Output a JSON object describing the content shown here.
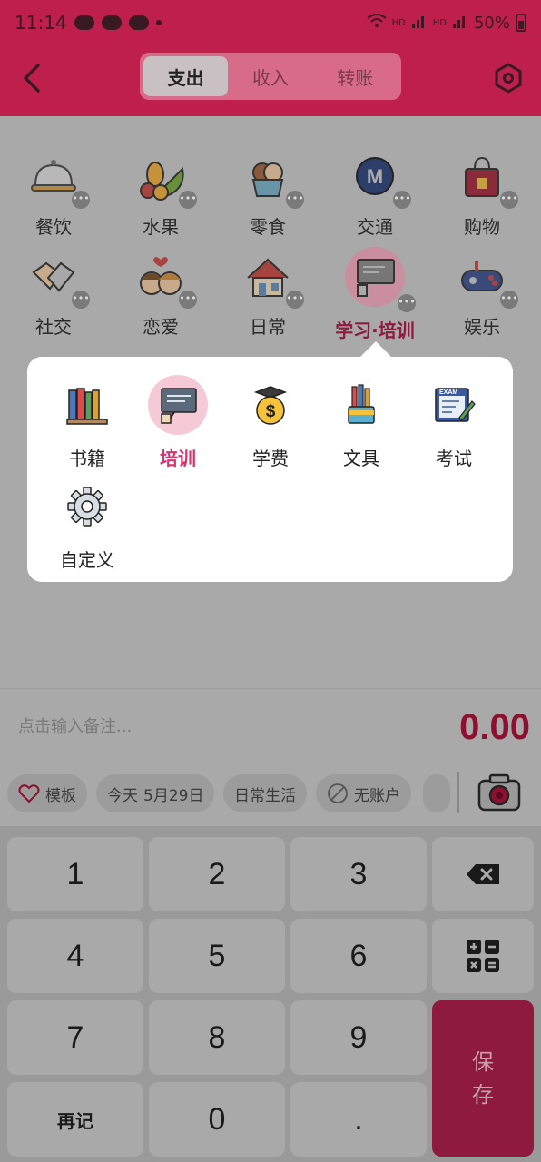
{
  "status": {
    "time": "11:14",
    "battery": "50%",
    "net1": "HD",
    "net2": "HD"
  },
  "header": {
    "tabs": [
      {
        "label": "支出",
        "active": true
      },
      {
        "label": "收入",
        "active": false
      },
      {
        "label": "转账",
        "active": false
      }
    ]
  },
  "categories": [
    {
      "label": "餐饮",
      "icon": "cloche-icon"
    },
    {
      "label": "水果",
      "icon": "fruit-icon"
    },
    {
      "label": "零食",
      "icon": "ice-cream-icon"
    },
    {
      "label": "交通",
      "icon": "metro-icon"
    },
    {
      "label": "购物",
      "icon": "shopping-bag-icon"
    },
    {
      "label": "社交",
      "icon": "handshake-icon"
    },
    {
      "label": "恋爱",
      "icon": "couple-icon"
    },
    {
      "label": "日常",
      "icon": "house-icon"
    },
    {
      "label": "学习·培训",
      "icon": "training-board-icon",
      "selected": true
    },
    {
      "label": "娱乐",
      "icon": "gamepad-icon"
    }
  ],
  "popup": {
    "items": [
      {
        "label": "书籍",
        "icon": "books-icon"
      },
      {
        "label": "培训",
        "icon": "training-board-icon",
        "selected": true
      },
      {
        "label": "学费",
        "icon": "tuition-coin-icon"
      },
      {
        "label": "文具",
        "icon": "stationery-icon"
      },
      {
        "label": "考试",
        "icon": "exam-icon"
      },
      {
        "label": "自定义",
        "icon": "gear-icon"
      }
    ]
  },
  "note": {
    "placeholder": "点击输入备注...",
    "amount": "0.00"
  },
  "chips": {
    "template": "模板",
    "date_prefix": "今天",
    "date": "5月29日",
    "book": "日常生活",
    "account": "无账户"
  },
  "keypad": {
    "keys": [
      "1",
      "2",
      "3",
      "4",
      "5",
      "6",
      "7",
      "8",
      "9",
      "再记",
      "0",
      "."
    ],
    "save_line1": "保",
    "save_line2": "存"
  },
  "colors": {
    "brand": "#d6336c",
    "brand_dim": "#bf1f4d",
    "amount": "#8e1030"
  }
}
